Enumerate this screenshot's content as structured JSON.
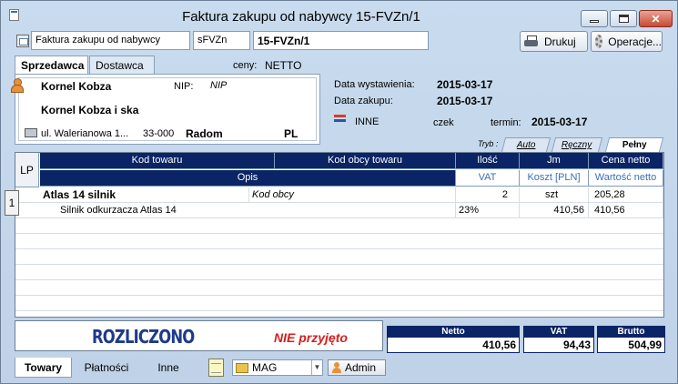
{
  "window": {
    "title": "Faktura zakupu od nabywcy 15-FVZn/1",
    "close_glyph": "✕"
  },
  "header": {
    "doc_type": "Faktura zakupu od nabywcy",
    "symbol": "sFVZn",
    "number": "15-FVZn/1",
    "print_label": "Drukuj",
    "operations_label": "Operacje..."
  },
  "party_tabs": {
    "seller": "Sprzedawca",
    "supplier": "Dostawca"
  },
  "prices": {
    "label": "ceny:",
    "value": "NETTO"
  },
  "seller": {
    "name": "Kornel Kobza",
    "nip_label": "NIP:",
    "nip_value": "NIP",
    "full_name": "Kornel Kobza i ska",
    "street": "ul. Walerianowa 1...",
    "zip": "33-000",
    "city": "Radom",
    "country": "PL"
  },
  "dates": {
    "issue_label": "Data wystawienia:",
    "issue_value": "2015-03-17",
    "purchase_label": "Data zakupu:",
    "purchase_value": "2015-03-17"
  },
  "payment": {
    "method": "INNE",
    "type": "czek",
    "term_label": "termin:",
    "term_value": "2015-03-17"
  },
  "mode": {
    "label": "Tryb :",
    "tabs": [
      "Auto",
      "Ręczny",
      "Pełny"
    ],
    "active": "Pełny"
  },
  "grid": {
    "lp_header": "LP",
    "headers_top": [
      "Kod towaru",
      "Kod obcy towaru",
      "Ilość",
      "Jm",
      "Cena netto"
    ],
    "headers_bottom": [
      "Opis",
      "VAT",
      "Koszt [PLN]",
      "Wartość netto"
    ],
    "rows": [
      {
        "lp": "1",
        "code": "Atlas 14 silnik",
        "foreign_code": "Kod obcy",
        "qty": "2",
        "unit": "szt",
        "price": "205,28",
        "description": "Silnik odkurzacza Atlas 14",
        "vat": "23%",
        "cost": "410,56",
        "net_value": "410,56"
      }
    ]
  },
  "status": {
    "settled": "ROZLICZONO",
    "accepted": "NIE przyjęto"
  },
  "totals": {
    "netto_label": "Netto",
    "netto": "410,56",
    "vat_label": "VAT",
    "vat": "94,43",
    "brutto_label": "Brutto",
    "brutto": "504,99"
  },
  "bottom_tabs": [
    "Towary",
    "Płatności",
    "Inne"
  ],
  "warehouse": "MAG",
  "user": "Admin",
  "colors": {
    "grid_header": "#0b2465",
    "settled_stamp": "#1d3a8c",
    "not_accepted": "#d41e1e",
    "window_bg": "#c5d7ea"
  }
}
